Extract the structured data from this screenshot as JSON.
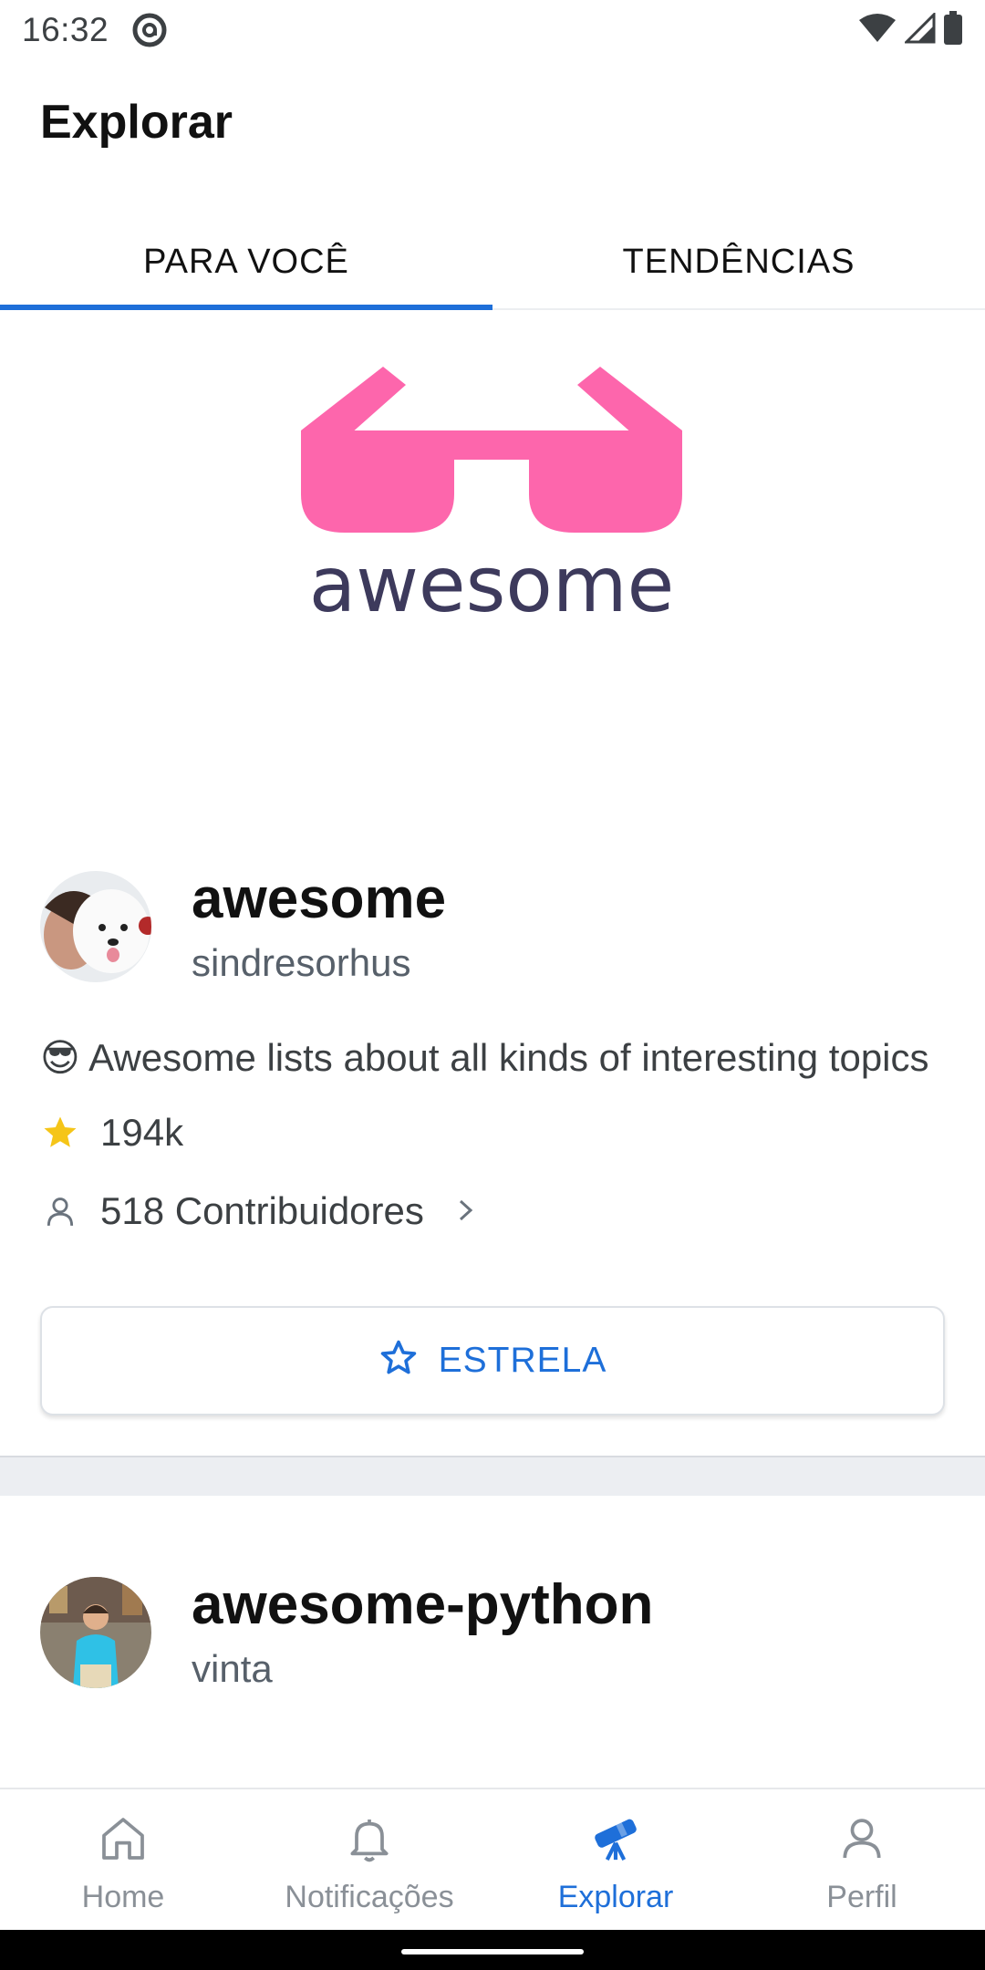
{
  "status_bar": {
    "time": "16:32",
    "icons": [
      "at-sign-icon",
      "wifi-icon",
      "signal-icon",
      "battery-icon"
    ]
  },
  "header": {
    "title": "Explorar"
  },
  "tabs": [
    {
      "label": "PARA VOCÊ",
      "active": true
    },
    {
      "label": "TENDÊNCIAS",
      "active": false
    }
  ],
  "colors": {
    "accent": "#1e6fd9",
    "logo_pink": "#fd66ac",
    "logo_text": "#3d3a5c",
    "star_yellow": "#f5c518"
  },
  "feed": {
    "repos": [
      {
        "logo_text": "awesome",
        "name": "awesome",
        "owner": "sindresorhus",
        "description_emoji": "😎",
        "description": "Awesome lists about all kinds of interesting topics",
        "stars": "194k",
        "contributors": "518 Contribuidores",
        "star_button": "ESTRELA"
      },
      {
        "name": "awesome-python",
        "owner": "vinta"
      }
    ]
  },
  "bottom_nav": [
    {
      "label": "Home",
      "icon": "home-icon",
      "active": false
    },
    {
      "label": "Notificações",
      "icon": "bell-icon",
      "active": false
    },
    {
      "label": "Explorar",
      "icon": "telescope-icon",
      "active": true
    },
    {
      "label": "Perfil",
      "icon": "person-icon",
      "active": false
    }
  ]
}
